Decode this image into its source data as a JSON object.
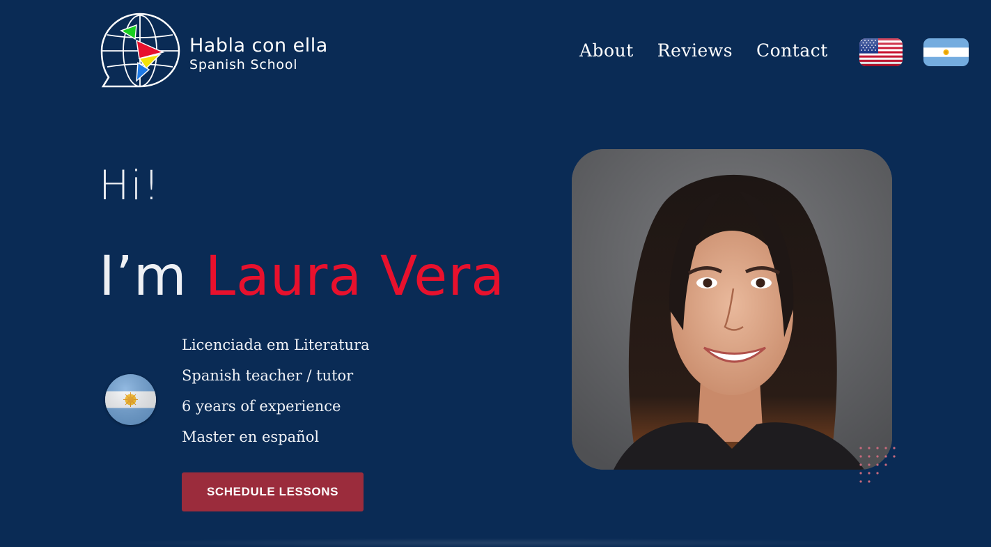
{
  "brand": {
    "title": "Habla con ella",
    "subtitle": "Spanish School"
  },
  "nav": {
    "items": [
      "About",
      "Reviews",
      "Contact"
    ]
  },
  "languages": {
    "english_icon": "us-flag-icon",
    "spanish_icon": "argentina-flag-icon"
  },
  "hero": {
    "greeting": "Hi!",
    "intro_prefix": "I’m",
    "name": "Laura Vera",
    "facts": [
      "Licenciada em Literatura",
      "Spanish teacher / tutor",
      "6 years of experience",
      "Master en español"
    ],
    "cta_label": "SCHEDULE LESSONS"
  },
  "colors": {
    "background": "#0a2b55",
    "accent_red": "#e8112d",
    "button": "#9b2c3c",
    "dots": "#c96a7d"
  }
}
